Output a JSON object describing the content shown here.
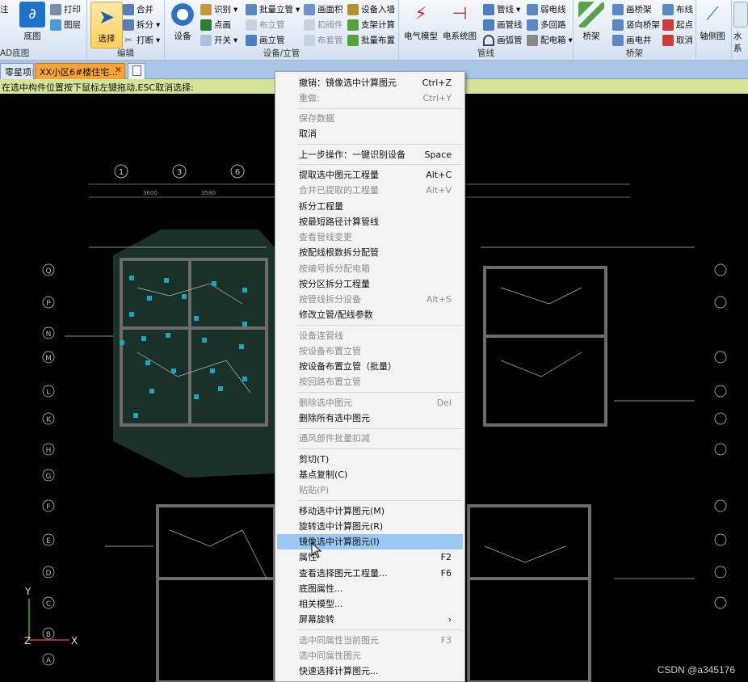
{
  "ribbon": {
    "cad_label": "AD底图",
    "base_map": "底图",
    "print": "打印",
    "layer": "图层",
    "edit": {
      "select": "选择",
      "merge": "合并",
      "split": "拆分",
      "break": "打断",
      "label": "编辑"
    },
    "device": {
      "device_btn": "设备",
      "identify": "识别",
      "point": "点画",
      "switch": "开关",
      "batch_riser": "批量立管",
      "place_riser": "布立管",
      "draw_riser": "画立管",
      "draw_box": "画面积",
      "valve": "扣阀件",
      "sleeve": "布套管",
      "device_in_wall": "设备入墙",
      "branch_calc": "支架计算",
      "batch_config": "批量布置",
      "label": "设备/立管"
    },
    "pipe": {
      "elec_model": "电气模型",
      "elec_system": "电系统图",
      "pipe_line": "管线",
      "draw_pipe": "画管线",
      "arc_pipe": "画弧管",
      "weak_line": "弱电线",
      "multi_loop": "多回路",
      "dist_box": "配电箱",
      "label": "管线"
    },
    "tray": {
      "tray_btn": "桥架",
      "draw_tray": "画桥架",
      "vertical_tray": "竖向桥架",
      "draw_well": "画电井",
      "wiring": "布线",
      "start_point": "起点",
      "cancel": "取消",
      "label": "桥架"
    },
    "axis": "轴侧图",
    "water": "水系"
  },
  "tabs": [
    {
      "label": "零星项目"
    },
    {
      "label": "XX小区6#楼住宅..."
    }
  ],
  "status_text": "在选中构件位置按下鼠标左键拖动,ESC取消选择:",
  "context_menu": {
    "items": [
      {
        "label": "撤销：镜像选中计算图元",
        "shortcut": "Ctrl+Z"
      },
      {
        "label": "重做:",
        "shortcut": "Ctrl+Y"
      },
      {
        "label": "保存数据",
        "shortcut": ""
      },
      {
        "label": "取消",
        "shortcut": ""
      },
      {
        "label": "上一步操作：一键识别设备",
        "shortcut": "Space"
      },
      {
        "label": "提取选中图元工程量",
        "shortcut": "Alt+C"
      },
      {
        "label": "合并已提取的工程量",
        "shortcut": "Alt+V"
      },
      {
        "label": "拆分工程量",
        "shortcut": ""
      },
      {
        "label": "按最短路径计算管线",
        "shortcut": ""
      },
      {
        "label": "查看管线变更",
        "shortcut": ""
      },
      {
        "label": "按配线根数拆分配管",
        "shortcut": ""
      },
      {
        "label": "按编号拆分配电箱",
        "shortcut": ""
      },
      {
        "label": "按分区拆分工程量",
        "shortcut": ""
      },
      {
        "label": "按管线拆分设备",
        "shortcut": "Alt+S"
      },
      {
        "label": "修改立管/配线参数",
        "shortcut": ""
      },
      {
        "label": "设备连管线",
        "shortcut": ""
      },
      {
        "label": "按设备布置立管",
        "shortcut": ""
      },
      {
        "label": "按设备布置立管（批量）",
        "shortcut": ""
      },
      {
        "label": "按回路布置立管",
        "shortcut": ""
      },
      {
        "label": "删除选中图元",
        "shortcut": "Del"
      },
      {
        "label": "删除所有选中图元",
        "shortcut": ""
      },
      {
        "label": "通风部件批量扣减",
        "shortcut": ""
      },
      {
        "label": "剪切(T)",
        "shortcut": ""
      },
      {
        "label": "基点复制(C)",
        "shortcut": ""
      },
      {
        "label": "粘贴(P)",
        "shortcut": ""
      },
      {
        "label": "移动选中计算图元(M)",
        "shortcut": ""
      },
      {
        "label": "旋转选中计算图元(R)",
        "shortcut": ""
      },
      {
        "label": "镜像选中计算图元(I)",
        "shortcut": ""
      },
      {
        "label": "属性",
        "shortcut": "F2"
      },
      {
        "label": "查看选择图元工程量...",
        "shortcut": "F6"
      },
      {
        "label": "底图属性...",
        "shortcut": ""
      },
      {
        "label": "相关模型...",
        "shortcut": ""
      },
      {
        "label": "屏幕旋转",
        "shortcut": "›"
      },
      {
        "label": "选中同属性当前图元",
        "shortcut": "F3"
      },
      {
        "label": "选中同属性图元",
        "shortcut": ""
      },
      {
        "label": "快速选择计算图元...",
        "shortcut": ""
      }
    ]
  },
  "canvas": {
    "axis_numbers": [
      "1",
      "3",
      "6"
    ],
    "dimensions": [
      "3600",
      "3580"
    ],
    "row_letters": [
      "Q",
      "P",
      "N",
      "M",
      "L",
      "K",
      "H",
      "G",
      "F",
      "E",
      "D",
      "C",
      "B",
      "A"
    ],
    "ucs": {
      "y": "Y",
      "x": "X",
      "z": "Z"
    }
  },
  "watermark": "CSDN @a345176"
}
